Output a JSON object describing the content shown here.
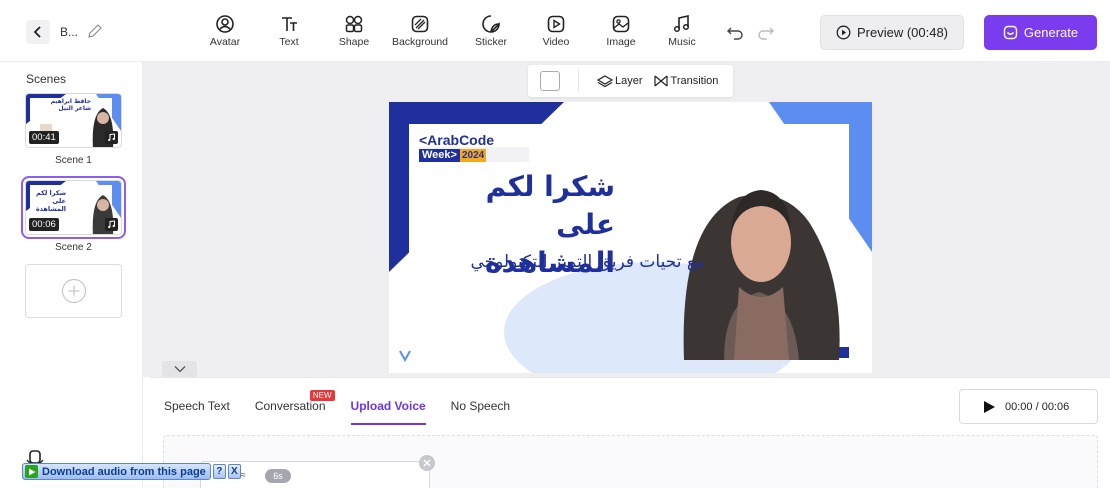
{
  "header": {
    "project_title": "B...",
    "tools": [
      {
        "label": "Avatar",
        "icon": "avatar-icon"
      },
      {
        "label": "Text",
        "icon": "text-icon"
      },
      {
        "label": "Shape",
        "icon": "shape-icon"
      },
      {
        "label": "Background",
        "icon": "background-icon"
      },
      {
        "label": "Sticker",
        "icon": "sticker-icon"
      },
      {
        "label": "Video",
        "icon": "video-icon"
      },
      {
        "label": "Image",
        "icon": "image-icon"
      },
      {
        "label": "Music",
        "icon": "music-icon"
      }
    ],
    "preview_label": "Preview (00:48)",
    "generate_label": "Generate"
  },
  "sidebar": {
    "title": "Scenes",
    "scenes": [
      {
        "label": "Scene 1",
        "duration": "00:41",
        "thumb_title": "حافظ ابراهيم شاعر النيل"
      },
      {
        "label": "Scene 2",
        "duration": "00:06",
        "thumb_title": "شكرا لكم على المشاهدة"
      }
    ]
  },
  "canvas_toolbar": {
    "layer_label": "Layer",
    "transition_label": "Transition"
  },
  "slide": {
    "brand_line1": "<ArabCode",
    "brand_week": "Week>",
    "brand_year": "2024",
    "title": "شكرا لكم على المشاهدة",
    "subtitle": "مع تحيات فريق التميز التكنولوجي"
  },
  "bottom": {
    "tabs": [
      "Speech Text",
      "Conversation",
      "Upload Voice",
      "No Speech"
    ],
    "active_tab": "Upload Voice",
    "new_badge": "NEW",
    "playback_time": "00:00 / 00:06",
    "audio_duration": "6s"
  },
  "download_bar": {
    "label": "Download audio from this page",
    "help": "?",
    "close": "X"
  },
  "colors": {
    "accent": "#7b3cf0",
    "brand_blue": "#1f2f9c",
    "light_blue": "#5b8ef0"
  }
}
